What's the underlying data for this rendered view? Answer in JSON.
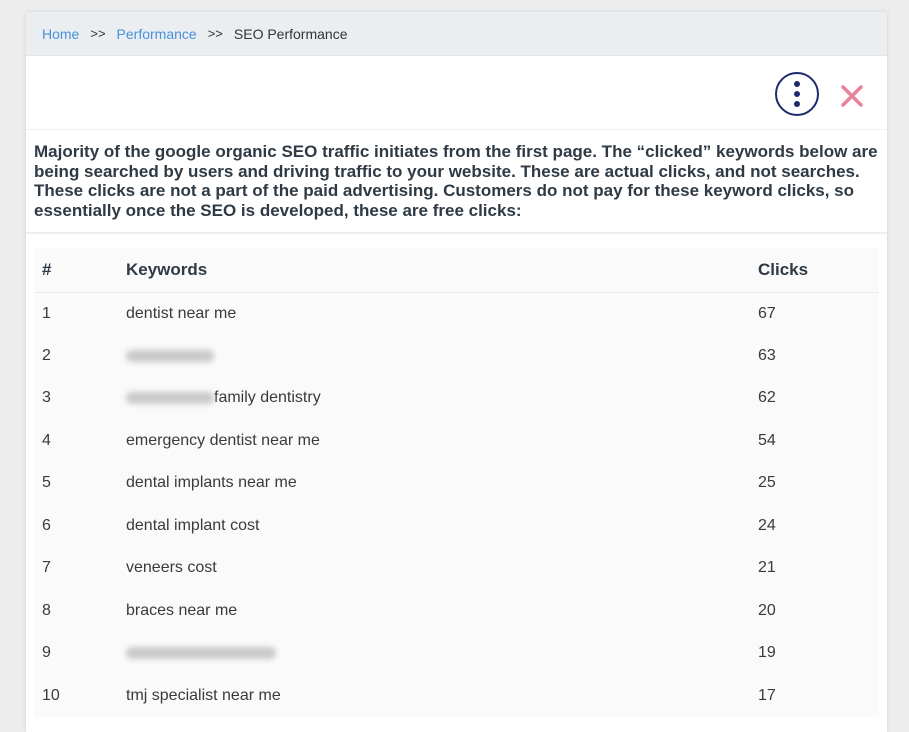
{
  "breadcrumb": {
    "items": [
      {
        "label": "Home"
      },
      {
        "label": "Performance"
      }
    ],
    "separator": ">>",
    "current": "SEO Performance"
  },
  "toolbar": {
    "more_icon": "vertical-ellipsis-icon",
    "close_icon": "close-icon",
    "accent": "#1f2a6b",
    "close_color": "#e8849a"
  },
  "intro": "Majority of the google organic SEO traffic initiates from the first page. The “clicked” keywords below are being searched by users and driving traffic to your website. These are actual clicks, and not searches. These clicks are not a part of the paid advertising. Customers do not pay for these keyword clicks, so essentially once the SEO is developed, these are free clicks:",
  "table": {
    "headers": {
      "num": "#",
      "keyword": "Keywords",
      "clicks": "Clicks"
    },
    "rows": [
      {
        "num": "1",
        "keyword": "dentist near me",
        "clicks": "67"
      },
      {
        "num": "2",
        "keyword": "",
        "blurred": true,
        "clicks": "63"
      },
      {
        "num": "3",
        "keyword": "family dentistry",
        "blurred": true,
        "clicks": "62"
      },
      {
        "num": "4",
        "keyword": "emergency dentist near me",
        "clicks": "54"
      },
      {
        "num": "5",
        "keyword": "dental implants near me",
        "clicks": "25"
      },
      {
        "num": "6",
        "keyword": "dental implant cost",
        "clicks": "24"
      },
      {
        "num": "7",
        "keyword": "veneers cost",
        "clicks": "21"
      },
      {
        "num": "8",
        "keyword": "braces near me",
        "clicks": "20"
      },
      {
        "num": "9",
        "keyword": "",
        "blurred": true,
        "clicks": "19"
      },
      {
        "num": "10",
        "keyword": "tmj specialist near me",
        "clicks": "17"
      }
    ]
  }
}
